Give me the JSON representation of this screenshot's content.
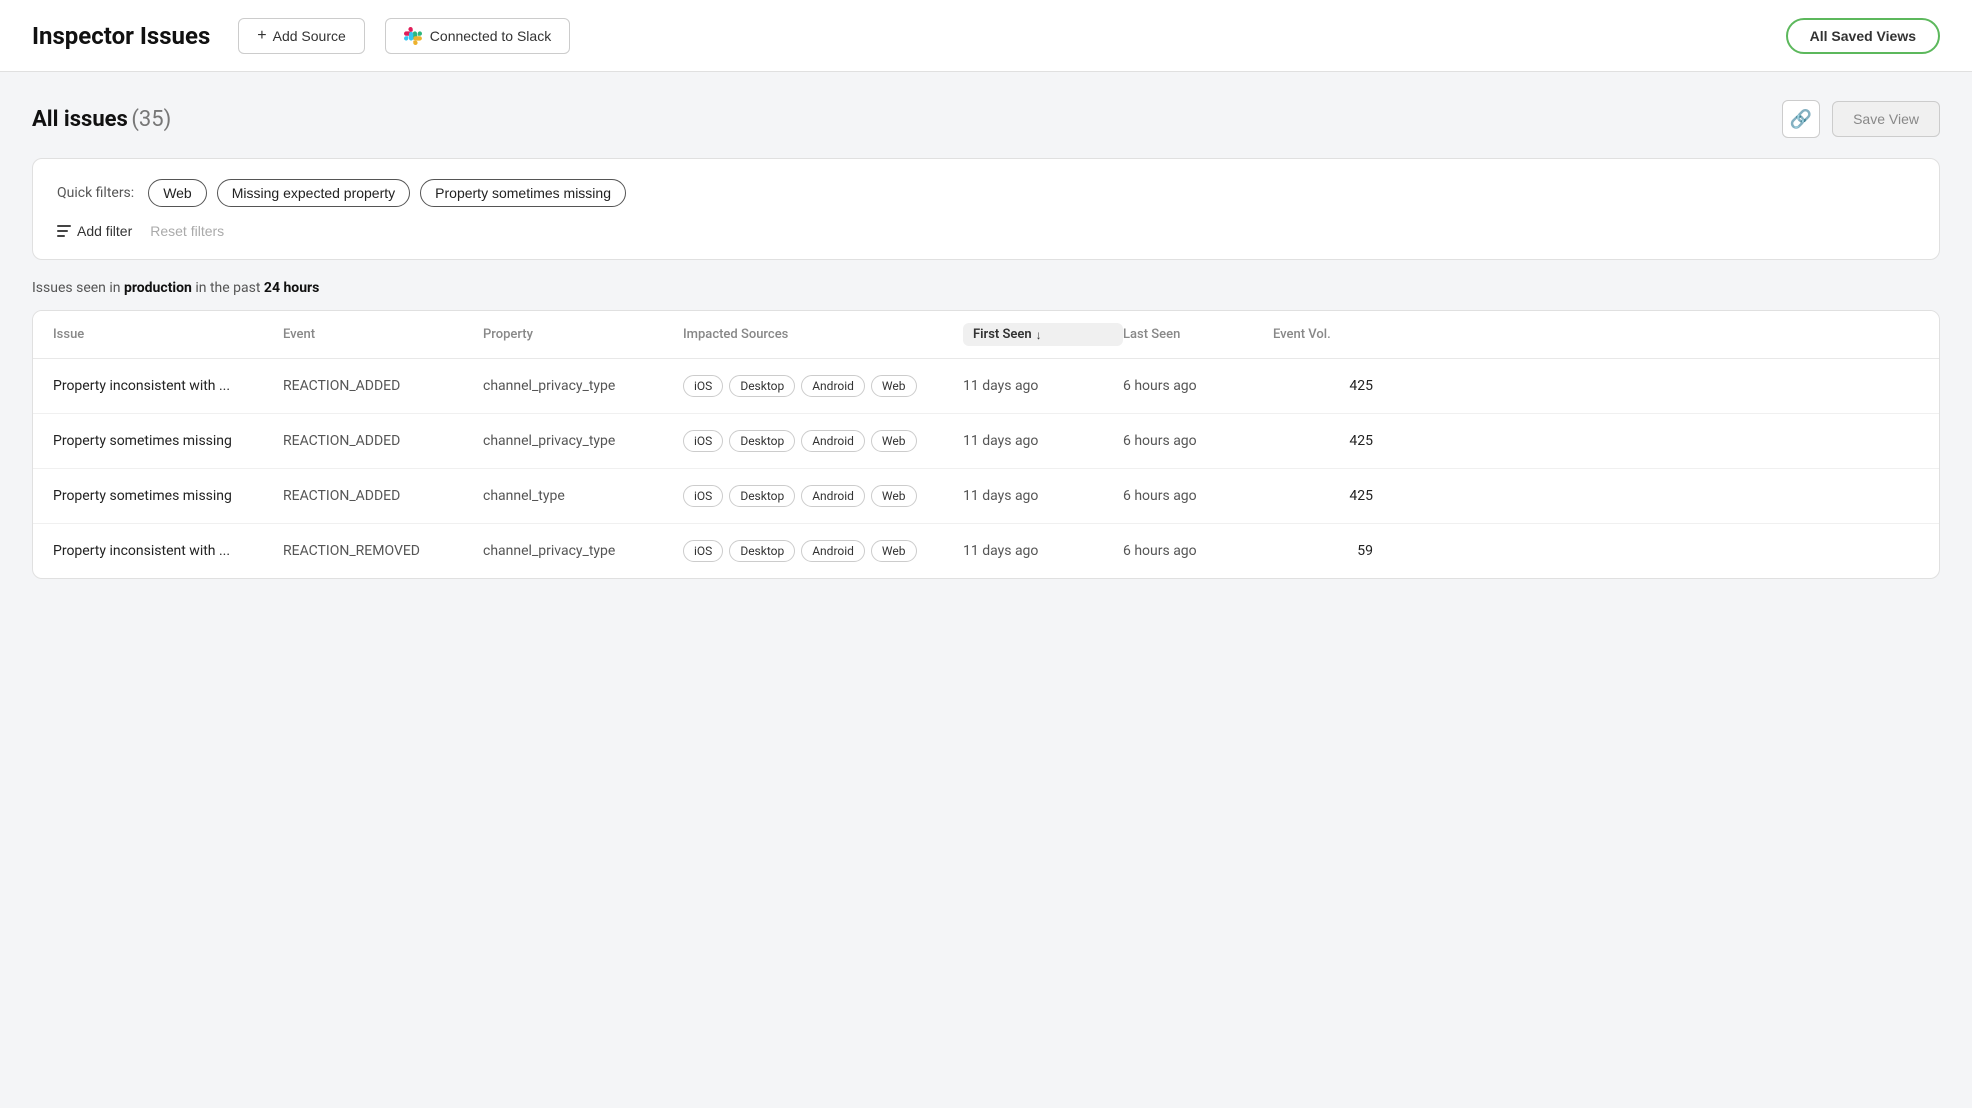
{
  "header": {
    "title": "Inspector Issues",
    "add_source_label": "Add Source",
    "connected_slack_label": "Connected to Slack",
    "all_saved_views_label": "All Saved Views"
  },
  "issues_section": {
    "title": "All issues",
    "count": "(35)",
    "link_icon": "🔗",
    "save_view_label": "Save View"
  },
  "filters": {
    "label": "Quick filters:",
    "chips": [
      "Web",
      "Missing expected property",
      "Property sometimes missing"
    ],
    "add_filter_label": "Add filter",
    "reset_filters_label": "Reset filters"
  },
  "issues_seen_text": {
    "prefix": "Issues seen in ",
    "env": "production",
    "middle": " in the past ",
    "period": "24 hours"
  },
  "table": {
    "columns": [
      {
        "id": "issue",
        "label": "Issue"
      },
      {
        "id": "event",
        "label": "Event"
      },
      {
        "id": "property",
        "label": "Property"
      },
      {
        "id": "impacted_sources",
        "label": "Impacted Sources"
      },
      {
        "id": "first_seen",
        "label": "First Seen",
        "sortable": true,
        "sort_dir": "↓"
      },
      {
        "id": "last_seen",
        "label": "Last Seen"
      },
      {
        "id": "event_vol",
        "label": "Event Vol."
      }
    ],
    "rows": [
      {
        "issue": "Property inconsistent with ...",
        "event": "REACTION_ADDED",
        "property": "channel_privacy_type",
        "tags": [
          "iOS",
          "Desktop",
          "Android",
          "Web"
        ],
        "first_seen": "11 days ago",
        "last_seen": "6 hours ago",
        "event_vol": "425"
      },
      {
        "issue": "Property sometimes missing",
        "event": "REACTION_ADDED",
        "property": "channel_privacy_type",
        "tags": [
          "iOS",
          "Desktop",
          "Android",
          "Web"
        ],
        "first_seen": "11 days ago",
        "last_seen": "6 hours ago",
        "event_vol": "425"
      },
      {
        "issue": "Property sometimes missing",
        "event": "REACTION_ADDED",
        "property": "channel_type",
        "tags": [
          "iOS",
          "Desktop",
          "Android",
          "Web"
        ],
        "first_seen": "11 days ago",
        "last_seen": "6 hours ago",
        "event_vol": "425"
      },
      {
        "issue": "Property inconsistent with ...",
        "event": "REACTION_REMOVED",
        "property": "channel_privacy_type",
        "tags": [
          "iOS",
          "Desktop",
          "Android",
          "Web"
        ],
        "first_seen": "11 days ago",
        "last_seen": "6 hours ago",
        "event_vol": "59"
      }
    ]
  }
}
